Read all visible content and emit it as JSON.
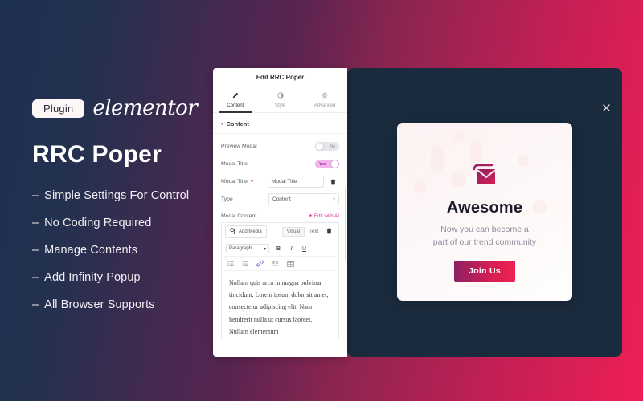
{
  "promo": {
    "badge": "Plugin",
    "brand": "elementor",
    "title": "RRC Poper",
    "features": [
      {
        "dash": "–",
        "label": "Simple Settings For Control"
      },
      {
        "dash": "–",
        "label": "No Coding Required"
      },
      {
        "dash": "–",
        "label": "Manage Contents"
      },
      {
        "dash": "–",
        "label": "Add Infinity Popup"
      },
      {
        "dash": "–",
        "label": "All Browser Supports"
      }
    ]
  },
  "panel": {
    "header_title": "Edit RRC Poper",
    "tabs": [
      {
        "label": "Content",
        "icon": "pencil-icon",
        "active": true
      },
      {
        "label": "Style",
        "icon": "contrast-icon",
        "active": false
      },
      {
        "label": "Advanced",
        "icon": "gear-icon",
        "active": false
      }
    ],
    "section": {
      "caret": "▾",
      "title": "Content"
    },
    "rows": {
      "preview_modal": {
        "label": "Preview Modal",
        "toggle_text": "No",
        "state": "off"
      },
      "modal_title_toggle": {
        "label": "Modal Title",
        "toggle_text": "Yes",
        "state": "on"
      },
      "modal_title_field": {
        "label": "Modal Title",
        "value": "Modal Title",
        "ai_icon": "ai-sparkle-icon",
        "trash_icon": "trash-icon"
      },
      "type": {
        "label": "Type",
        "value": "Content",
        "chevron": "▾"
      }
    },
    "modal_content": {
      "label": "Modal Content",
      "edit_with_ai": "Edit with AI",
      "add_media": "Add Media",
      "editor_tabs": [
        {
          "label": "Visual",
          "active": true
        },
        {
          "label": "Text",
          "active": false
        }
      ],
      "trash_icon": "trash-icon",
      "paragraph_select": {
        "value": "Paragraph",
        "chevron": "▾"
      },
      "format_buttons": [
        {
          "label": "B",
          "name": "bold-button"
        },
        {
          "label": "I",
          "name": "italic-button"
        },
        {
          "label": "U",
          "name": "underline-button"
        }
      ],
      "toolbar_icons": [
        "bulleted-list-icon",
        "numbered-list-icon",
        "link-icon",
        "read-more-icon",
        "table-icon"
      ],
      "body_text": "Nullam quis arcu in magna pulvinar tincidunt. Lorem ipsum dolor sit amet, consectetur adipiscing elit. Nam hendrerit nulla ut cursus laoreet. Nullam elementum"
    }
  },
  "preview": {
    "close_icon": "close-icon",
    "envelope_icon": "envelope-icon",
    "title": "Awesome",
    "subtitle_line1": "Now you can become a",
    "subtitle_line2": "part of our trend community",
    "button_label": "Join Us"
  },
  "colors": {
    "bg_navy": "#1e3050",
    "bg_pink": "#ee1f55",
    "card_navy": "#1a2b3d",
    "accent_magenta": "#d6379c",
    "toggle_on": "#f0b5ef",
    "button_gradient_start": "#8e2063",
    "button_gradient_end": "#ef2152"
  }
}
